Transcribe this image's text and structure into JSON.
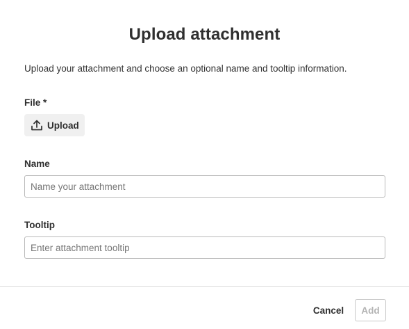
{
  "dialog": {
    "title": "Upload attachment",
    "description": "Upload your attachment and choose an optional name and tooltip information."
  },
  "file_field": {
    "label": "File *",
    "upload_button_label": "Upload",
    "upload_icon": "upload-icon"
  },
  "name_field": {
    "label": "Name",
    "value": "",
    "placeholder": "Name your attachment"
  },
  "tooltip_field": {
    "label": "Tooltip",
    "value": "",
    "placeholder": "Enter attachment tooltip"
  },
  "footer": {
    "cancel_label": "Cancel",
    "add_label": "Add",
    "add_disabled": true
  }
}
